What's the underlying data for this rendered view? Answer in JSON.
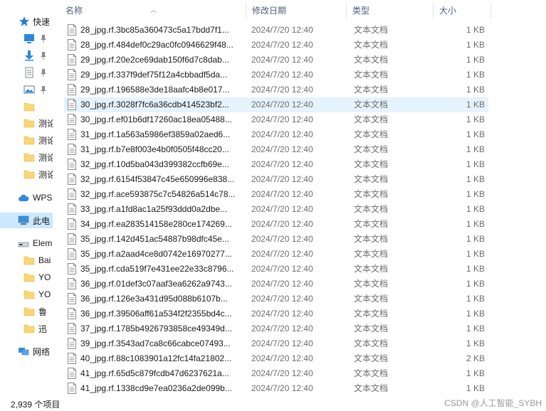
{
  "nav": {
    "quick_access": "快速",
    "folders": [
      "测论",
      "测论",
      "测论",
      "测论"
    ],
    "wps": "WPS",
    "this_pc": "此电",
    "drive": "Elem",
    "drive_folders": [
      "Bai",
      "YO",
      "YO",
      "鲁",
      "迅"
    ],
    "network": "网络"
  },
  "header": {
    "name": "名称",
    "date": "修改日期",
    "type": "类型",
    "size": "大小"
  },
  "files": [
    {
      "name": "28_jpg.rf.3bc85a360473c5a17bdd7f1...",
      "date": "2024/7/20 12:40",
      "type": "文本文档",
      "size": "1 KB"
    },
    {
      "name": "28_jpg.rf.484def0c29ac0fc0946629f48...",
      "date": "2024/7/20 12:40",
      "type": "文本文档",
      "size": "1 KB"
    },
    {
      "name": "29_jpg.rf.20e2ce69dab150f6d7c8dab...",
      "date": "2024/7/20 12:40",
      "type": "文本文档",
      "size": "1 KB"
    },
    {
      "name": "29_jpg.rf.337f9def75f12a4cbbadf5da...",
      "date": "2024/7/20 12:40",
      "type": "文本文档",
      "size": "1 KB"
    },
    {
      "name": "29_jpg.rf.196588e3de18aafc4b8e017...",
      "date": "2024/7/20 12:40",
      "type": "文本文档",
      "size": "1 KB"
    },
    {
      "name": "30_jpg.rf.3028f7fc6a36cdb414523bf2...",
      "date": "2024/7/20 12:40",
      "type": "文本文档",
      "size": "1 KB",
      "selected": true
    },
    {
      "name": "30_jpg.rf.ef01b6df17260ac18ea05488...",
      "date": "2024/7/20 12:40",
      "type": "文本文档",
      "size": "1 KB"
    },
    {
      "name": "31_jpg.rf.1a563a5986ef3859a02aed6...",
      "date": "2024/7/20 12:40",
      "type": "文本文档",
      "size": "1 KB"
    },
    {
      "name": "31_jpg.rf.b7e8f003e4b0f0505f48cc20...",
      "date": "2024/7/20 12:40",
      "type": "文本文档",
      "size": "1 KB"
    },
    {
      "name": "32_jpg.rf.10d5ba043d399382ccfb69e...",
      "date": "2024/7/20 12:40",
      "type": "文本文档",
      "size": "1 KB"
    },
    {
      "name": "32_jpg.rf.6154f53847c45e650996e838...",
      "date": "2024/7/20 12:40",
      "type": "文本文档",
      "size": "1 KB"
    },
    {
      "name": "32_jpg.rf.ace593875c7c54826a514c78...",
      "date": "2024/7/20 12:40",
      "type": "文本文档",
      "size": "1 KB"
    },
    {
      "name": "33_jpg.rf.a1fd8ac1a25f93ddd0a2dbe...",
      "date": "2024/7/20 12:40",
      "type": "文本文档",
      "size": "1 KB"
    },
    {
      "name": "34_jpg.rf.ea283514158e280ce174269...",
      "date": "2024/7/20 12:40",
      "type": "文本文档",
      "size": "1 KB"
    },
    {
      "name": "35_jpg.rf.142d451ac54887b98dfc45e...",
      "date": "2024/7/20 12:40",
      "type": "文本文档",
      "size": "1 KB"
    },
    {
      "name": "35_jpg.rf.a2aad4ce8d0742e16970277...",
      "date": "2024/7/20 12:40",
      "type": "文本文档",
      "size": "1 KB"
    },
    {
      "name": "35_jpg.rf.cda519f7e431ee22e33c8796...",
      "date": "2024/7/20 12:40",
      "type": "文本文档",
      "size": "1 KB"
    },
    {
      "name": "36_jpg.rf.01def3c07aaf3ea6262a9743...",
      "date": "2024/7/20 12:40",
      "type": "文本文档",
      "size": "1 KB"
    },
    {
      "name": "36_jpg.rf.126e3a431d95d088b6107b...",
      "date": "2024/7/20 12:40",
      "type": "文本文档",
      "size": "1 KB"
    },
    {
      "name": "36_jpg.rf.39506aff61a534f2f2355bd4c...",
      "date": "2024/7/20 12:40",
      "type": "文本文档",
      "size": "1 KB"
    },
    {
      "name": "37_jpg.rf.1785b4926793858ce49349d...",
      "date": "2024/7/20 12:40",
      "type": "文本文档",
      "size": "1 KB"
    },
    {
      "name": "39_jpg.rf.3543ad7ca8c66cabce07493...",
      "date": "2024/7/20 12:40",
      "type": "文本文档",
      "size": "1 KB"
    },
    {
      "name": "40_jpg.rf.88c1083901a12fc14fa21802...",
      "date": "2024/7/20 12:40",
      "type": "文本文档",
      "size": "2 KB"
    },
    {
      "name": "41_jpg.rf.65d5c879fcdb47d6237621a...",
      "date": "2024/7/20 12:40",
      "type": "文本文档",
      "size": "1 KB"
    },
    {
      "name": "41_jpg.rf.1338cd9e7ea0236a2de099b...",
      "date": "2024/7/20 12:40",
      "type": "文本文档",
      "size": "1 KB"
    }
  ],
  "status": {
    "item_count": "2,939 个项目"
  },
  "watermark": "CSDN @人工智能_SYBH",
  "colors": {
    "selected_row": "#e5f3ff",
    "nav_selected": "#cce8ff",
    "header_text": "#4c607a",
    "folder_yellow": "#f8d775"
  }
}
